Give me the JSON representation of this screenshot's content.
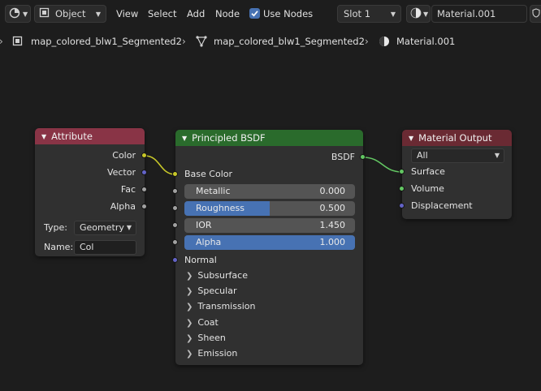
{
  "header": {
    "object_mode": "Object",
    "menu": {
      "view": "View",
      "select": "Select",
      "add": "Add",
      "node": "Node"
    },
    "use_nodes_label": "Use Nodes",
    "use_nodes_checked": true,
    "slot": "Slot 1",
    "material_name": "Material.001"
  },
  "breadcrumb": {
    "object": "map_colored_blw1_Segmented2",
    "mesh": "map_colored_blw1_Segmented2",
    "material": "Material.001"
  },
  "colors": {
    "attribute_header": "#893446",
    "shader_header": "#2a6b2c",
    "output_header": "#6a2a33",
    "socket_color": "#c7c729",
    "socket_vector": "#6363c7",
    "socket_float": "#a1a1a1",
    "socket_shader": "#63c763",
    "field_fill": "#4772b3"
  },
  "nodes": {
    "attribute": {
      "title": "Attribute",
      "outputs": [
        "Color",
        "Vector",
        "Fac",
        "Alpha"
      ],
      "type_label": "Type:",
      "type_value": "Geometry",
      "name_label": "Name:",
      "name_value": "Col"
    },
    "principled": {
      "title": "Principled BSDF",
      "output": "BSDF",
      "base_color": "Base Color",
      "fields": [
        {
          "label": "Metallic",
          "value": "0.000",
          "fraction": 0.0
        },
        {
          "label": "Roughness",
          "value": "0.500",
          "fraction": 0.5
        },
        {
          "label": "IOR",
          "value": "1.450",
          "fraction": 0.0
        },
        {
          "label": "Alpha",
          "value": "1.000",
          "fraction": 1.0
        }
      ],
      "normal": "Normal",
      "panels": [
        "Subsurface",
        "Specular",
        "Transmission",
        "Coat",
        "Sheen",
        "Emission"
      ]
    },
    "output": {
      "title": "Material Output",
      "target": "All",
      "inputs": [
        "Surface",
        "Volume",
        "Displacement"
      ]
    }
  }
}
